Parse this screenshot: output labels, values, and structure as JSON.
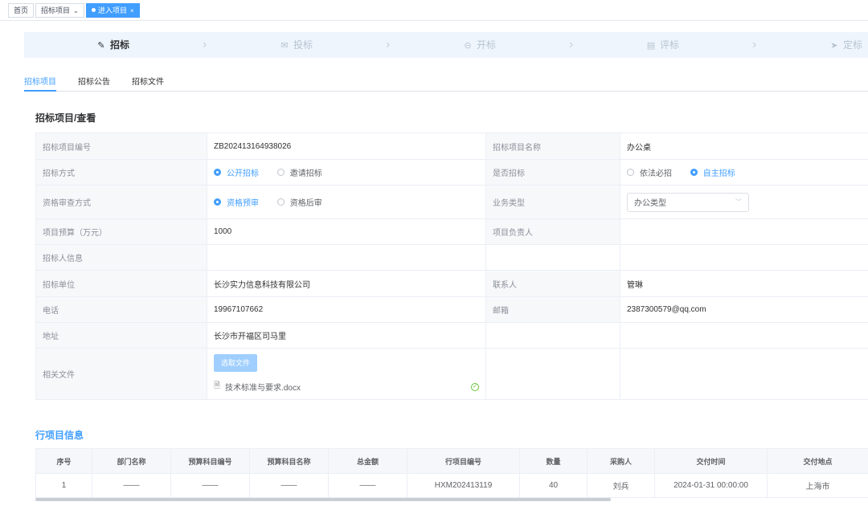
{
  "tabs": {
    "home": "首页",
    "project": "招标项目",
    "active": "进入项目",
    "dropdown_glyph": "⌄",
    "close_glyph": "×"
  },
  "steps": [
    {
      "label": "招标",
      "icon": "edit-icon",
      "glyph": "✎",
      "current": true
    },
    {
      "label": "投标",
      "icon": "mail-icon",
      "glyph": "✉",
      "current": false
    },
    {
      "label": "开标",
      "icon": "link-icon",
      "glyph": "⊝",
      "current": false
    },
    {
      "label": "评标",
      "icon": "message-icon",
      "glyph": "▤",
      "current": false
    },
    {
      "label": "定标",
      "icon": "send-icon",
      "glyph": "➤",
      "current": false
    }
  ],
  "subtabs": [
    "招标项目",
    "招标公告",
    "招标文件"
  ],
  "section_title": "招标项目/查看",
  "form": {
    "project_no_label": "招标项目编号",
    "project_no": "ZB202413164938026",
    "project_name_label": "招标项目名称",
    "project_name": "办公桌",
    "method_label": "招标方式",
    "method_options": [
      "公开招标",
      "邀请招标"
    ],
    "method_selected": 0,
    "is_bidding_label": "是否招标",
    "is_bidding_options": [
      "依法必招",
      "自主招标"
    ],
    "is_bidding_selected": 1,
    "qualification_label": "资格审查方式",
    "qualification_options": [
      "资格预审",
      "资格后审"
    ],
    "qualification_selected": 0,
    "business_type_label": "业务类型",
    "business_type": "办公类型",
    "budget_label": "项目预算（万元）",
    "budget": "1000",
    "owner_label": "项目负责人",
    "owner": "",
    "tenderer_info_label": "招标人信息",
    "unit_label": "招标单位",
    "unit": "长沙实力信息科技有限公司",
    "contact_label": "联系人",
    "contact": "管琳",
    "phone_label": "电话",
    "phone": "19967107662",
    "email_label": "邮箱",
    "email": "2387300579@qq.com",
    "address_label": "地址",
    "address": "长沙市开福区司马里",
    "files_label": "相关文件",
    "upload_button": "选取文件",
    "file_name": "技术标准与要求.docx",
    "file_check_glyph": "✓"
  },
  "line_items": {
    "title": "行项目信息",
    "columns": [
      "序号",
      "部门名称",
      "预算科目编号",
      "预算科目名称",
      "总金额",
      "行项目编号",
      "数量",
      "采购人",
      "交付时间",
      "交付地点"
    ],
    "rows": [
      [
        "1",
        "——",
        "——",
        "——",
        "——",
        "HXM202413119",
        "40",
        "刘兵",
        "2024-01-31 00:00:00",
        "上海市"
      ]
    ]
  },
  "colors": {
    "primary": "#409eff",
    "steps_bg": "#eef5fd",
    "label_bg": "#f7f8fa",
    "success": "#67c23a"
  }
}
